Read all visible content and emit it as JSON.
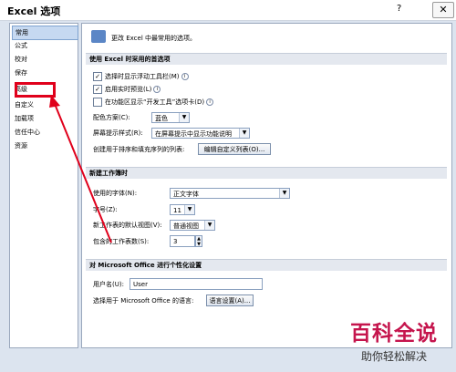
{
  "window": {
    "title": "Excel 选项",
    "help": "?",
    "close": "✕"
  },
  "sidebar": {
    "items": [
      {
        "label": "常用",
        "active": true
      },
      {
        "label": "公式"
      },
      {
        "label": "校对"
      },
      {
        "label": "保存"
      },
      {
        "label": "高级"
      },
      {
        "label": "自定义"
      },
      {
        "label": "加载项"
      },
      {
        "label": "信任中心"
      },
      {
        "label": "资源"
      }
    ]
  },
  "banner": {
    "text": "更改 Excel 中最常用的选项。"
  },
  "sections": {
    "top": "使用 Excel 时采用的首选项",
    "new_workbook": "新建工作簿时",
    "personalize": "对 Microsoft Office 进行个性化设置"
  },
  "options": {
    "floatie": {
      "label": "选择时显示浮动工具栏(M)",
      "checked": "✓"
    },
    "live_preview": {
      "label": "启用实时预览(L)",
      "checked": "✓"
    },
    "developer_tab": {
      "label": "在功能区显示“开发工具”选项卡(D)",
      "checked": ""
    },
    "color_scheme": {
      "label": "配色方案(C):",
      "value": "蓝色"
    },
    "screentip": {
      "label": "屏幕提示样式(R):",
      "value": "在屏幕提示中显示功能说明"
    },
    "custom_list": {
      "label": "创建用于排序和填充序列的列表:",
      "button": "编辑自定义列表(O)..."
    }
  },
  "new_workbook": {
    "font": {
      "label": "使用的字体(N):",
      "value": "正文字体"
    },
    "size": {
      "label": "字号(Z):",
      "value": "11"
    },
    "view": {
      "label": "新工作表的默认视图(V):",
      "value": "普通视图"
    },
    "sheets": {
      "label": "包含的工作表数(S):",
      "value": "3"
    }
  },
  "personalize": {
    "username": {
      "label": "用户名(U):",
      "value": "User"
    },
    "language": {
      "label": "选择用于 Microsoft Office 的语言:",
      "button": "语言设置(A)..."
    }
  },
  "watermark": {
    "big": "百科全说",
    "small": "助你轻松解决"
  }
}
